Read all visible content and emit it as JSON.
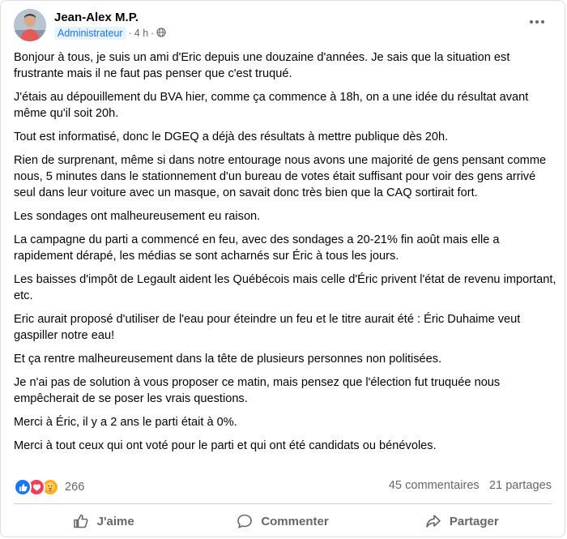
{
  "post": {
    "author": "Jean-Alex M.P.",
    "badge": "Administrateur",
    "time": "4 h",
    "separator": "·",
    "paragraphs": [
      "Bonjour à tous, je suis un ami d'Eric depuis une douzaine d'années. Je sais que la situation est frustrante mais il ne faut pas penser que c'est truqué.",
      "J'étais au dépouillement du BVA hier, comme ça commence à 18h, on a une idée du résultat avant même qu'il soit 20h.",
      "Tout est informatisé, donc le DGEQ a déjà des résultats à mettre publique dès 20h.",
      "Rien de surprenant, même si dans notre entourage nous avons une majorité de gens pensant comme nous, 5 minutes dans le stationnement d'un bureau de votes était suffisant pour voir des gens arrivé seul dans leur voiture avec un masque, on savait donc très bien que la CAQ sortirait fort.",
      "Les sondages ont malheureusement eu raison.",
      "La campagne du parti a commencé en feu, avec des sondages a 20-21% fin août mais elle a rapidement dérapé, les médias se sont acharnés sur Éric à tous les jours.",
      "Les baisses d'impôt de Legault aident les Québécois mais celle d'Éric privent l'état de revenu important, etc.",
      "Eric aurait proposé d'utiliser de l'eau pour éteindre un feu et le titre aurait été : Éric Duhaime veut gaspiller notre eau!",
      "Et ça rentre malheureusement dans la tête de plusieurs personnes non politisées.",
      "Je n'ai pas de solution à vous proposer ce matin, mais pensez que l'élection fut truquée nous empêcherait de se poser les vrais questions.",
      "Merci à Éric, il y a 2 ans le parti était à 0%.",
      "Merci à tout ceux qui ont voté pour le parti et qui ont été candidats ou bénévoles."
    ]
  },
  "stats": {
    "reaction_count": "266",
    "comments": "45 commentaires",
    "shares": "21 partages"
  },
  "actions": {
    "like": "J'aime",
    "comment": "Commenter",
    "share": "Partager"
  },
  "colors": {
    "like_blue": "#1877f2",
    "love_red": "#f33e58",
    "care_yellow": "#f7b125",
    "muted_text": "#65676b"
  },
  "icons": {
    "more": "more-horizontal-icon",
    "privacy": "globe-icon",
    "like": "thumbs-up-icon",
    "comment": "speech-bubble-icon",
    "share": "share-arrow-icon"
  }
}
